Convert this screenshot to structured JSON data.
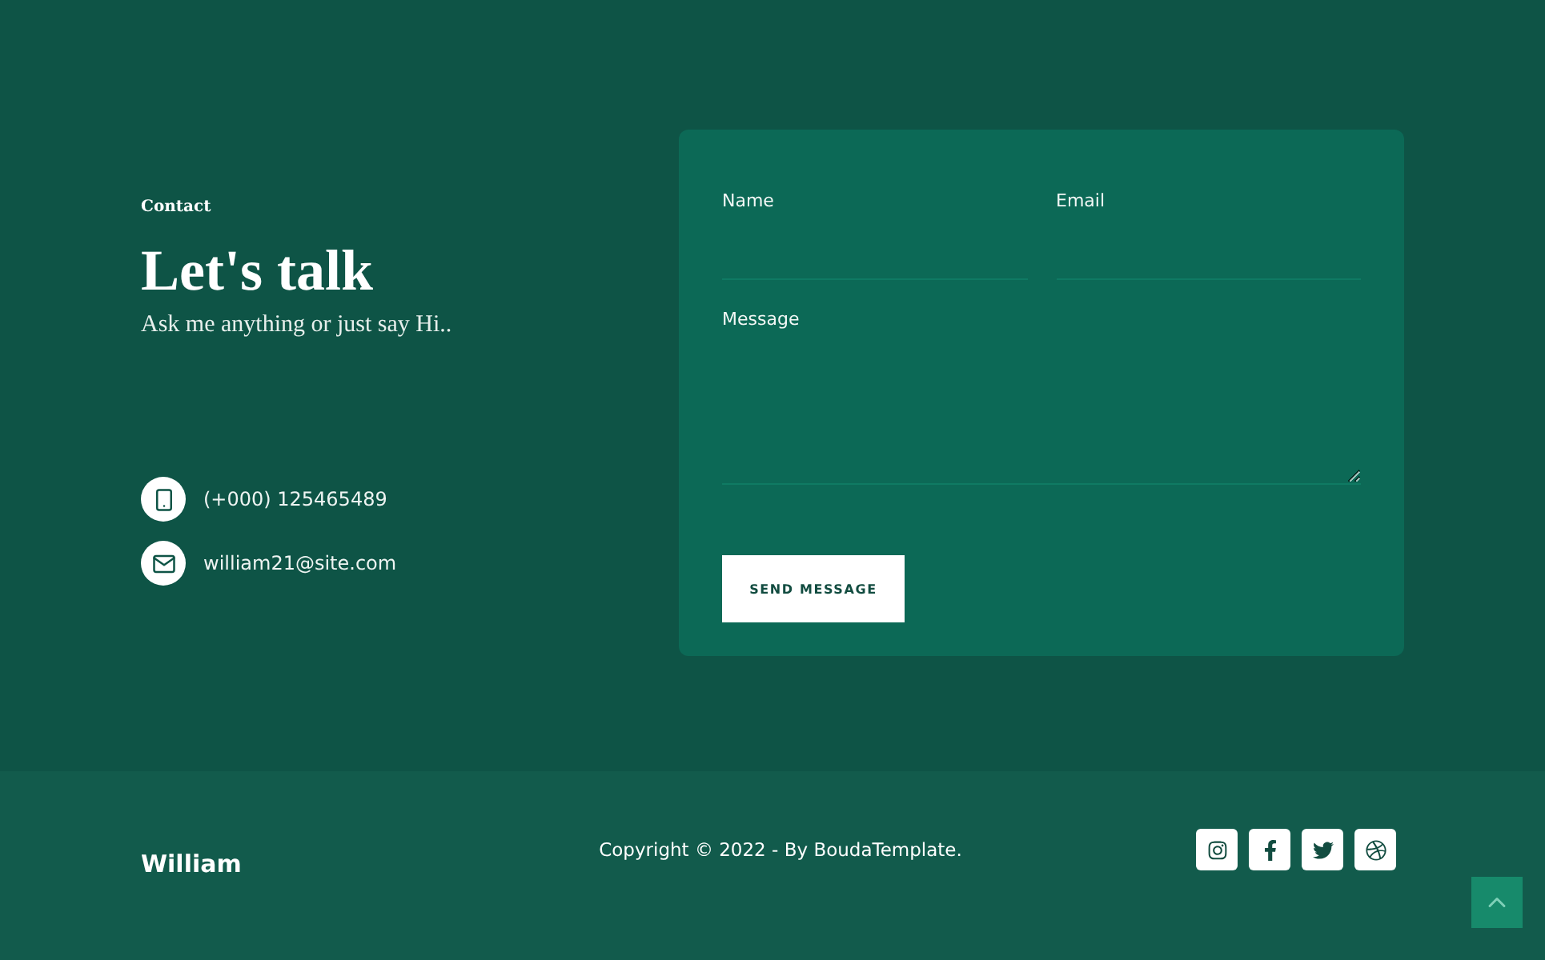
{
  "intro": {
    "eyebrow": "Contact",
    "heading": "Let's talk",
    "subtitle": "Ask me anything or just say Hi.."
  },
  "contacts": [
    {
      "kind": "phone",
      "text": "(+000) 125465489"
    },
    {
      "kind": "email",
      "text": "william21@site.com"
    }
  ],
  "form": {
    "fields": [
      {
        "label": "Name",
        "kind": "line"
      },
      {
        "label": "Email",
        "kind": "line"
      },
      {
        "label": "Message",
        "kind": "area"
      }
    ],
    "button": "SEND MESSAGE"
  },
  "footer": {
    "brand": "William",
    "copyright": "Copyright © 2022 - By BoudaTemplate.",
    "socials": [
      {
        "kind": "instagram"
      },
      {
        "kind": "facebook"
      },
      {
        "kind": "twitter"
      },
      {
        "kind": "dribbble"
      }
    ]
  }
}
